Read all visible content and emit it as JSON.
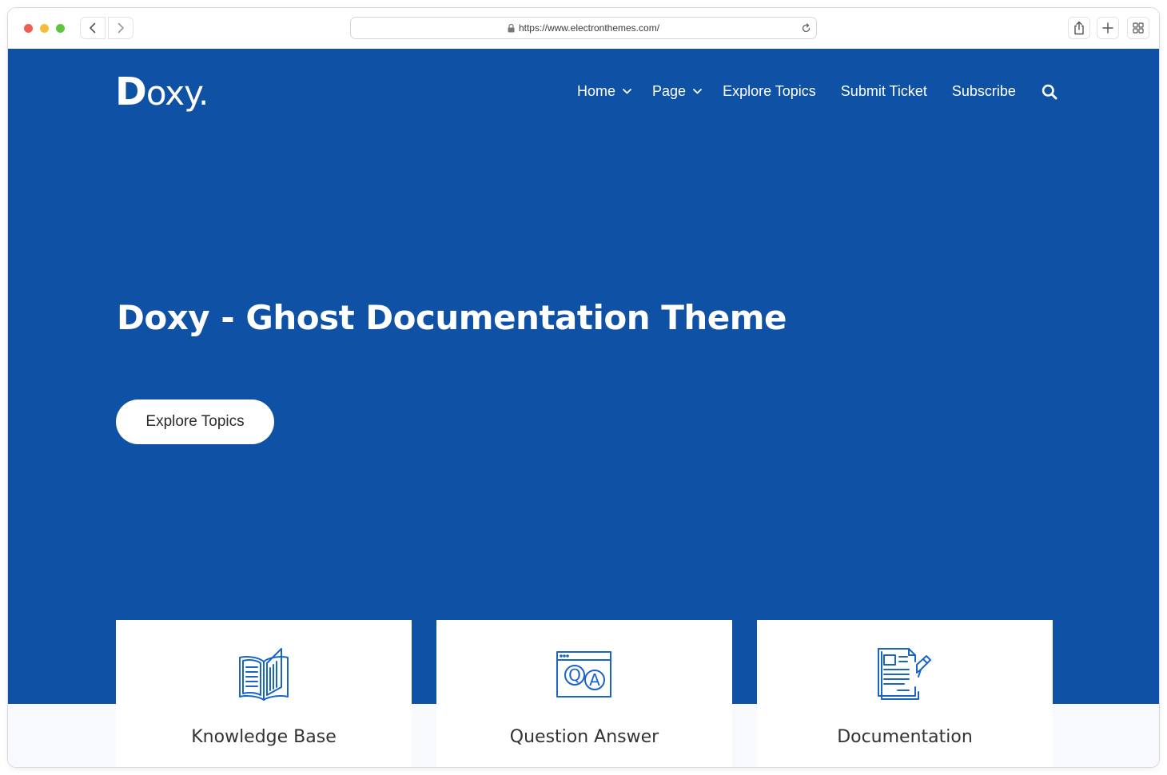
{
  "browser": {
    "url": "https://www.electronthemes.com/"
  },
  "site": {
    "logo": {
      "first": "D",
      "rest": "oxy."
    },
    "nav": [
      {
        "label": "Home",
        "has_dropdown": true
      },
      {
        "label": "Page",
        "has_dropdown": true
      },
      {
        "label": "Explore Topics",
        "has_dropdown": false
      },
      {
        "label": "Submit Ticket",
        "has_dropdown": false
      },
      {
        "label": "Subscribe",
        "has_dropdown": false
      }
    ],
    "search_icon": "search-icon",
    "hero": {
      "title": "Doxy - Ghost Documentation Theme",
      "button_label": "Explore Topics"
    },
    "cards": [
      {
        "title": "Knowledge Base",
        "icon": "open-book-icon"
      },
      {
        "title": "Question Answer",
        "icon": "qa-window-icon"
      },
      {
        "title": "Documentation",
        "icon": "document-pen-icon"
      }
    ],
    "colors": {
      "hero_background": "#0f51a5",
      "icon_blue": "#1a64c8",
      "card_text": "#333333"
    }
  }
}
